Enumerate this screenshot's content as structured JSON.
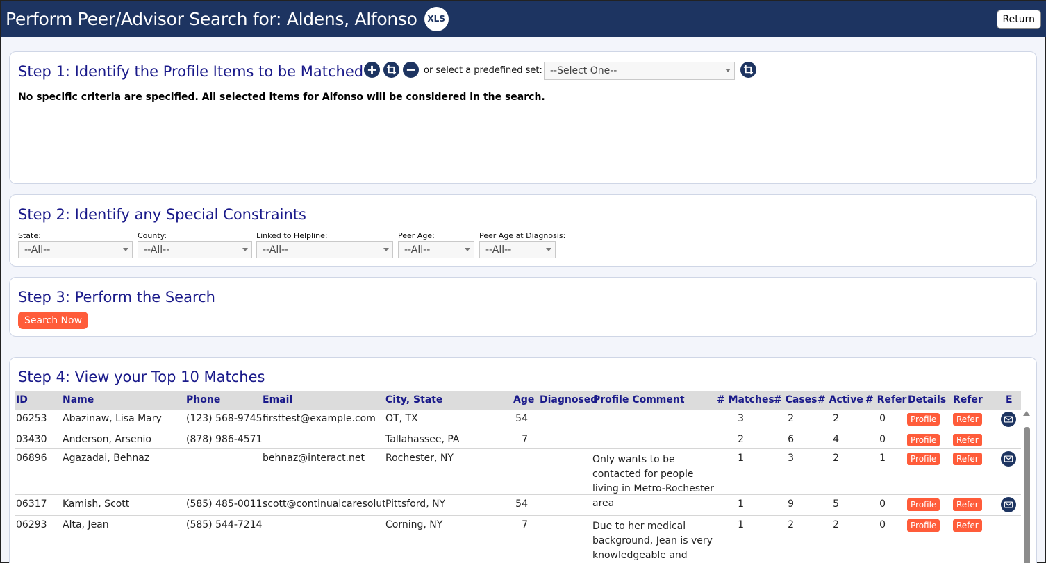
{
  "header": {
    "title": "Perform Peer/Advisor Search for: Aldens, Alfonso",
    "xls_label": "XLS",
    "return_label": "Return"
  },
  "step1": {
    "title": "Step 1: Identify the Profile Items to be Matched",
    "predefined_label": "or select a predefined set:",
    "predefined_value": "--Select One--",
    "note": "No specific criteria are specified. All selected items for Alfonso will be considered in the search."
  },
  "step2": {
    "title": "Step 2: Identify any Special Constraints",
    "filters": [
      {
        "label": "State:",
        "value": "--All--"
      },
      {
        "label": "County:",
        "value": "--All--"
      },
      {
        "label": "Linked to Helpline:",
        "value": "--All--"
      },
      {
        "label": "Peer Age:",
        "value": "--All--"
      },
      {
        "label": "Peer Age at Diagnosis:",
        "value": "--All--"
      }
    ]
  },
  "step3": {
    "title": "Step 3: Perform the Search",
    "search_label": "Search Now"
  },
  "step4": {
    "title": "Step 4: View your Top 10 Matches",
    "columns": [
      "ID",
      "Name",
      "Phone",
      "Email",
      "City, State",
      "Age",
      "Diagnosed",
      "Profile Comment",
      "# Matches",
      "# Cases",
      "# Active",
      "# Refer",
      "Details",
      "Refer",
      "E"
    ],
    "rows": [
      {
        "id": "06253",
        "name": "Abazinaw, Lisa Mary",
        "phone": "(123) 568-9745",
        "email": "firsttest@example.com",
        "city": "OT, TX",
        "age": "54",
        "diagnosed": "",
        "comment": "",
        "matches": "3",
        "cases": "2",
        "active": "2",
        "refer": "0",
        "profile_btn": "Profile",
        "refer_btn": "Refer",
        "has_email": true
      },
      {
        "id": "03430",
        "name": "Anderson, Arsenio",
        "phone": "(878) 986-4571",
        "email": "",
        "city": "Tallahassee, PA",
        "age": "7",
        "diagnosed": "",
        "comment": "",
        "matches": "2",
        "cases": "6",
        "active": "4",
        "refer": "0",
        "profile_btn": "Profile",
        "refer_btn": "Refer",
        "has_email": false
      },
      {
        "id": "06896",
        "name": "Agazadai, Behnaz",
        "phone": "",
        "email": "behnaz@interact.net",
        "city": "Rochester, NY",
        "age": "",
        "diagnosed": "",
        "comment": "Only wants to be contacted for people living in Metro-Rochester area",
        "matches": "1",
        "cases": "3",
        "active": "2",
        "refer": "1",
        "profile_btn": "Profile",
        "refer_btn": "Refer",
        "has_email": true
      },
      {
        "id": "06317",
        "name": "Kamish, Scott",
        "phone": "(585) 485-0011",
        "email": "scott@continualcaresolutio",
        "city": "Pittsford, NY",
        "age": "54",
        "diagnosed": "",
        "comment": "",
        "matches": "1",
        "cases": "9",
        "active": "5",
        "refer": "0",
        "profile_btn": "Profile",
        "refer_btn": "Refer",
        "has_email": true
      },
      {
        "id": "06293",
        "name": "Alta, Jean",
        "phone": "(585) 544-7214",
        "email": "",
        "city": "Corning, NY",
        "age": "7",
        "diagnosed": "",
        "comment": "Due to her medical background, Jean is very knowledgeable and always",
        "matches": "1",
        "cases": "2",
        "active": "2",
        "refer": "0",
        "profile_btn": "Profile",
        "refer_btn": "Refer",
        "has_email": false
      }
    ]
  }
}
